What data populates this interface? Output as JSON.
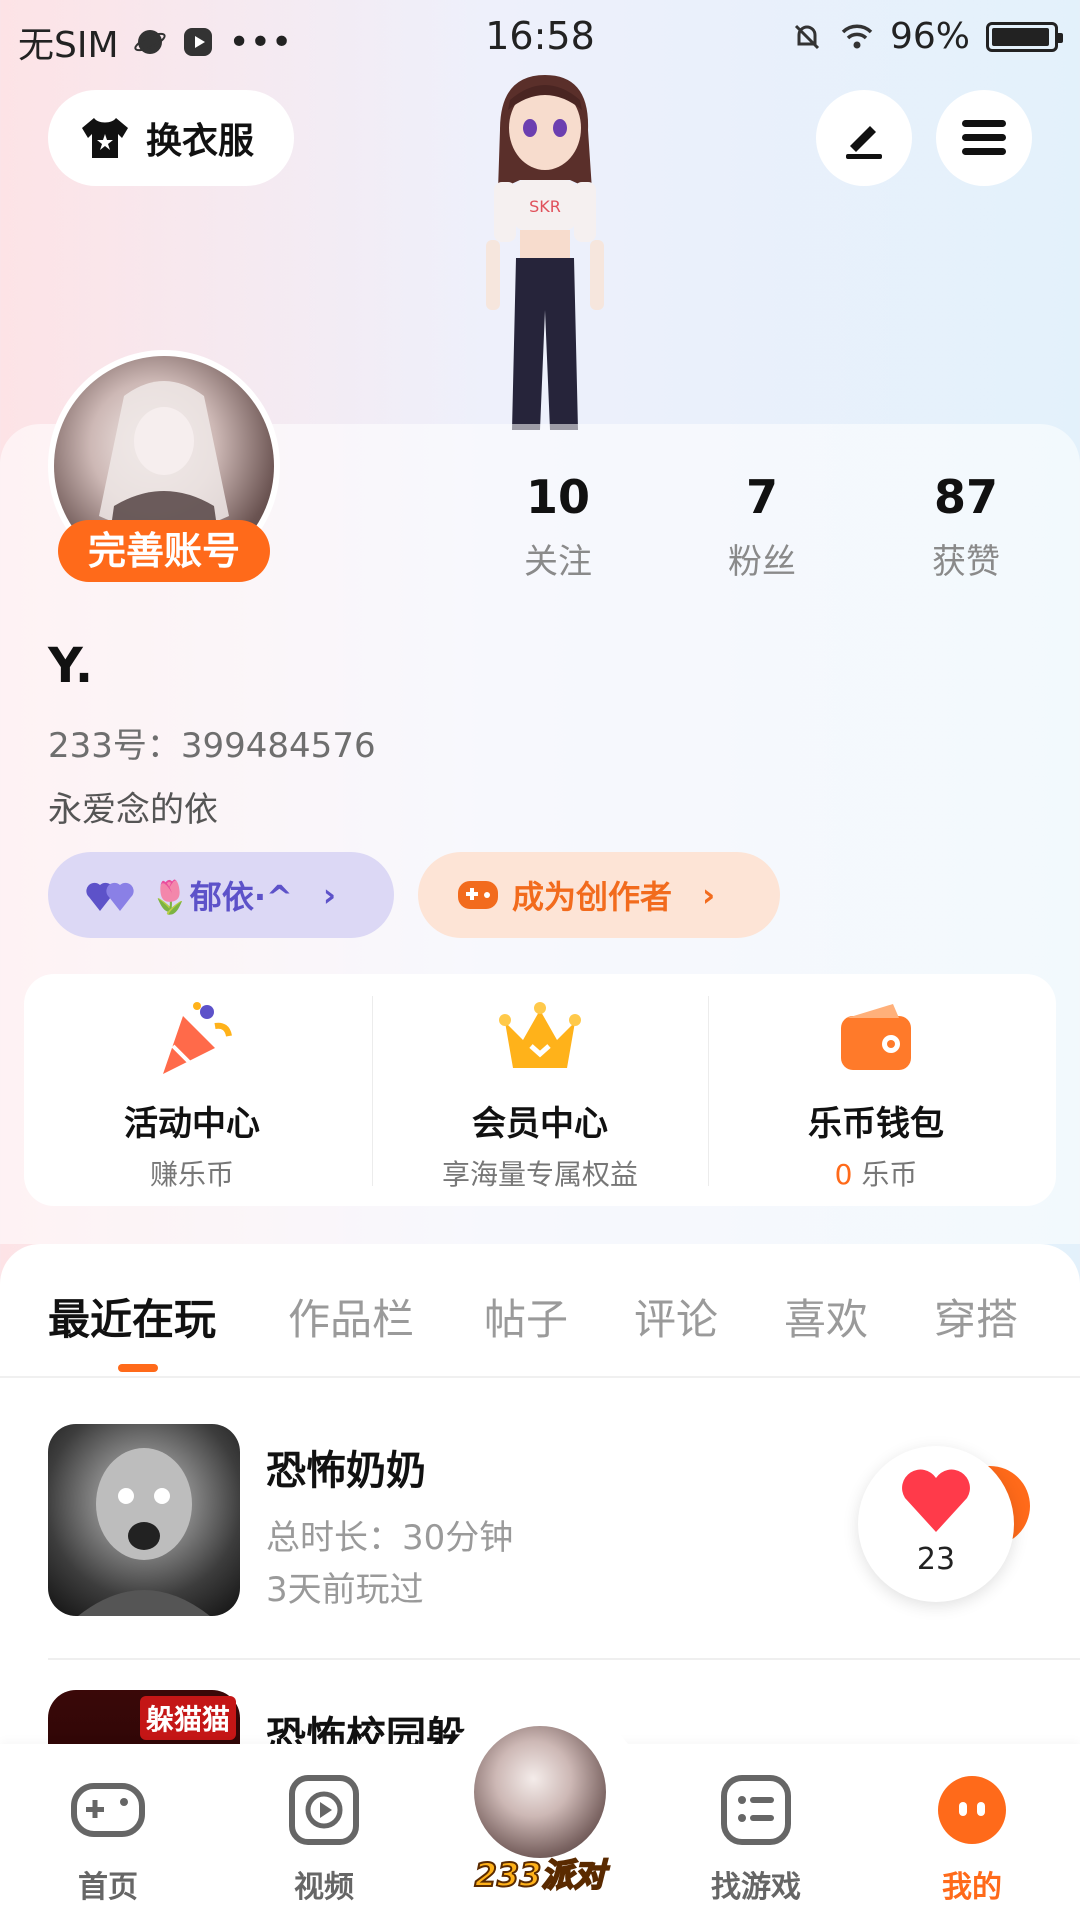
{
  "status_bar": {
    "carrier": "无SIM",
    "time": "16:58",
    "battery": "96%"
  },
  "top_actions": {
    "outfit_label": "换衣服"
  },
  "profile": {
    "complete_label": "完善账号",
    "username": "Y.",
    "account_id": "233号：399484576",
    "bio": "永爱念的依",
    "stats": [
      {
        "value": "10",
        "label": "关注"
      },
      {
        "value": "7",
        "label": "粉丝"
      },
      {
        "value": "87",
        "label": "获赞"
      }
    ],
    "fan_pill_label": "🌷郁依·^",
    "creator_pill_label": "成为创作者"
  },
  "services": [
    {
      "title": "活动中心",
      "subtitle": "赚乐币",
      "icon": "party-popper-icon"
    },
    {
      "title": "会员中心",
      "subtitle": "享海量专属权益",
      "icon": "crown-icon"
    },
    {
      "title": "乐币钱包",
      "subtitle_value": "0",
      "subtitle_unit": "乐币",
      "icon": "wallet-icon"
    }
  ],
  "tabs": [
    "最近在玩",
    "作品栏",
    "帖子",
    "评论",
    "喜欢",
    "穿搭"
  ],
  "recent_games": [
    {
      "name": "恐怖奶奶",
      "duration": "总时长：30分钟",
      "last_played": "3天前玩过"
    },
    {
      "name": "恐怖校园躲",
      "thumb_label": "躲猫猫"
    }
  ],
  "like_count": "23",
  "bottom_nav": [
    {
      "label": "首页",
      "icon": "gamepad-icon"
    },
    {
      "label": "视频",
      "icon": "video-play-icon"
    },
    {
      "label": "233派对",
      "icon": "party-avatar"
    },
    {
      "label": "找游戏",
      "icon": "game-list-icon"
    },
    {
      "label": "我的",
      "icon": "me-face-icon"
    }
  ],
  "colors": {
    "accent": "#ff6a1a",
    "fan_pill_bg": "#dcd8f5",
    "fan_pill_text": "#5d52c9",
    "creator_pill_bg": "#fde4d6"
  }
}
